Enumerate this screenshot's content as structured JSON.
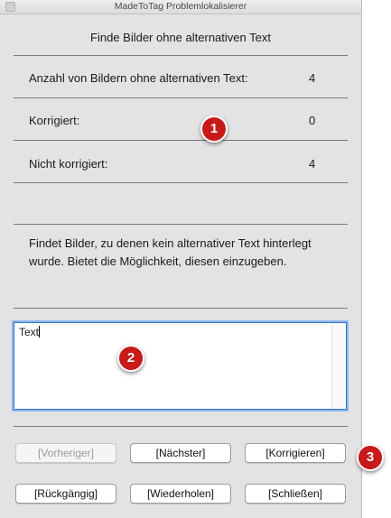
{
  "window": {
    "title": "MadeToTag Problemlokalisierer"
  },
  "heading": "Finde Bilder ohne alternativen Text",
  "stats": [
    {
      "label": "Anzahl von Bildern ohne alternativen Text:",
      "value": "4"
    },
    {
      "label": "Korrigiert:",
      "value": "0"
    },
    {
      "label": "Nicht korrigiert:",
      "value": "4"
    }
  ],
  "description": "Findet Bilder, zu denen kein alternativer Text hinterlegt wurde. Bietet die Möglichkeit, diesen einzugeben.",
  "text_field": {
    "value": "Text"
  },
  "buttons": {
    "previous": "[Vorheriger]",
    "next": "[Nächster]",
    "correct": "[Korrigieren]",
    "undo": "[Rückgängig]",
    "redo": "[Wiederholen]",
    "close": "[Schließen]"
  },
  "callouts": [
    "1",
    "2",
    "3"
  ],
  "colors": {
    "callout": "#c81a1a",
    "focus_ring": "#3a73c5"
  }
}
